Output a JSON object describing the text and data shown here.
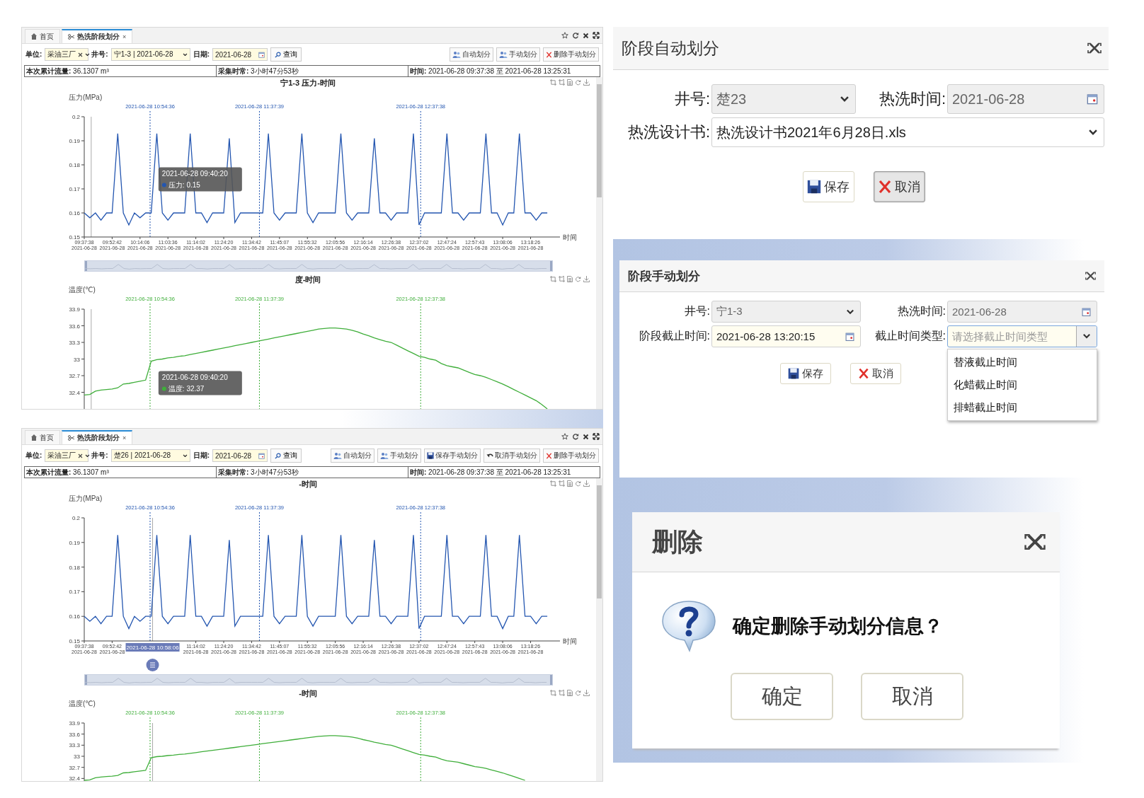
{
  "dashboard_panels": [
    {
      "tabs": [
        {
          "label": "首页",
          "kind": "home",
          "selected": false
        },
        {
          "label": "热洗阶段划分",
          "kind": "tool",
          "selected": true,
          "close": "×"
        }
      ],
      "filters": [
        {
          "label": "单位:",
          "value": "采油三厂",
          "kind": "clearable"
        },
        {
          "label": "井号:",
          "value": "宁1-3 | 2021-06-28",
          "kind": "select"
        },
        {
          "label": "日期:",
          "value": "2021-06-28",
          "kind": "date"
        }
      ],
      "query_button": "查询",
      "actions": [
        {
          "label": "自动划分",
          "kind": "auto"
        },
        {
          "label": "手动划分",
          "kind": "manual"
        },
        {
          "label": "删除手动划分",
          "kind": "delete"
        }
      ],
      "summary": [
        "**本次累计流量:** 36.1307 m³",
        "**采集时常:** 3小时47分53秒",
        "**时间:** 2021-06-28 09:37:38 至 2021-06-28 13:25:31"
      ],
      "zoom_slider": {
        "level": 1
      },
      "charts": [
        {
          "tooltip": {
            "title": "2021-06-28 09:40:20",
            "text": "压力: 0.15"
          },
          "chart_data": {
            "type": "line",
            "title": "宁1-3 压力-时间",
            "xlabel": "时间",
            "ylabel": "压力(MPa)",
            "categories": [
              "09:37:38 2021-06-28",
              null,
              null,
              null,
              null,
              "09:52:42 2021-06-28",
              null,
              null,
              null,
              null,
              "10:14:06 2021-06-28",
              null,
              null,
              null,
              null,
              "11:03:36 2021-06-28",
              null,
              null,
              null,
              null,
              "11:14:02 2021-06-28",
              null,
              null,
              null,
              null,
              "11:24:20 2021-06-28",
              null,
              null,
              null,
              null,
              "11:34:42 2021-06-28",
              null,
              null,
              null,
              null,
              "11:45:07 2021-06-28",
              null,
              null,
              null,
              null,
              "11:55:32 2021-06-28",
              null,
              null,
              null,
              null,
              "12:05:56 2021-06-28",
              null,
              null,
              null,
              null,
              "12:16:14 2021-06-28",
              null,
              null,
              null,
              null,
              "12:26:38 2021-06-28",
              null,
              null,
              null,
              null,
              "12:37:02 2021-06-28",
              null,
              null,
              null,
              null,
              "12:47:24 2021-06-28",
              null,
              null,
              null,
              null,
              "12:57:43 2021-06-28",
              null,
              null,
              null,
              null,
              "13:08:06 2021-06-28",
              null,
              null,
              null,
              null,
              "13:18:26 2021-06-28",
              null,
              null,
              null
            ],
            "series": [
              {
                "color": "#2456b0",
                "values": [
                  0.16,
                  0.158,
                  0.16,
                  0.157,
                  0.16,
                  0.16,
                  0.193,
                  0.16,
                  0.155,
                  0.16,
                  0.158,
                  0.16,
                  0.16,
                  0.193,
                  0.16,
                  0.157,
                  0.16,
                  0.16,
                  0.16,
                  0.193,
                  0.16,
                  0.16,
                  0.156,
                  0.16,
                  0.16,
                  0.16,
                  0.191,
                  0.156,
                  0.16,
                  0.16,
                  0.16,
                  0.16,
                  0.16,
                  0.193,
                  0.16,
                  0.157,
                  0.16,
                  0.16,
                  0.16,
                  0.193,
                  0.16,
                  0.156,
                  0.16,
                  0.16,
                  0.16,
                  0.16,
                  0.193,
                  0.16,
                  0.157,
                  0.16,
                  0.16,
                  0.16,
                  0.191,
                  0.16,
                  0.16,
                  0.157,
                  0.16,
                  0.16,
                  0.16,
                  0.193,
                  0.155,
                  0.16,
                  0.16,
                  0.16,
                  0.16,
                  0.193,
                  0.16,
                  0.16,
                  0.157,
                  0.16,
                  0.16,
                  0.16,
                  0.193,
                  0.16,
                  0.16,
                  0.155,
                  0.16,
                  0.16,
                  0.193,
                  0.16,
                  0.16,
                  0.157,
                  0.16,
                  0.16
                ]
              }
            ],
            "ylim": [
              0.15,
              0.2
            ],
            "yticks": [
              {
                "value": 0.15,
                "label": "0.15"
              },
              {
                "value": 0.16,
                "label": "0.16"
              },
              {
                "value": 0.17,
                "label": "0.17"
              },
              {
                "value": 0.18,
                "label": "0.18"
              },
              {
                "value": 0.19,
                "label": "0.19"
              },
              {
                "value": 0.2,
                "label": "0.2"
              }
            ],
            "annotations": [
              "2021-06-28 10:54:36",
              "2021-06-28 11:37:39",
              "2021-06-28 12:37:38"
            ]
          }
        },
        {
          "tooltip": {
            "title": "2021-06-28 09:40:20",
            "text": "温度: 32.37"
          },
          "chart_data": {
            "type": "line",
            "title": "度-时间",
            "ylabel": "温度(℃)",
            "categories": [
              null,
              null,
              null,
              null,
              null,
              null,
              null,
              null,
              null,
              null,
              null,
              null,
              null,
              null,
              null,
              null,
              null,
              null,
              null,
              null,
              null,
              null,
              null,
              null,
              null,
              null,
              null,
              null,
              null,
              null,
              null,
              null,
              null,
              null,
              null,
              null,
              null,
              null,
              null,
              null,
              null,
              null,
              null,
              null,
              null,
              null,
              null,
              null,
              null,
              null,
              null,
              null,
              null,
              null,
              null,
              null,
              null,
              null,
              null,
              null,
              null,
              null,
              null,
              null,
              null,
              null,
              null,
              null,
              null,
              null,
              null,
              null,
              null,
              null,
              null,
              null,
              null,
              null,
              null,
              null,
              null,
              null,
              null,
              null
            ],
            "series": [
              {
                "color": "#3fae3a",
                "values": [
                  32.35,
                  32.36,
                  32.42,
                  32.44,
                  32.45,
                  32.46,
                  32.48,
                  32.55,
                  32.56,
                  32.58,
                  32.6,
                  32.62,
                  32.96,
                  32.99,
                  33.0,
                  33.02,
                  33.03,
                  33.05,
                  33.06,
                  33.08,
                  33.1,
                  33.12,
                  33.14,
                  33.16,
                  33.18,
                  33.2,
                  33.22,
                  33.24,
                  33.26,
                  33.28,
                  33.3,
                  33.32,
                  33.34,
                  33.36,
                  33.38,
                  33.4,
                  33.42,
                  33.44,
                  33.46,
                  33.48,
                  33.5,
                  33.52,
                  33.54,
                  33.55,
                  33.56,
                  33.56,
                  33.55,
                  33.54,
                  33.52,
                  33.49,
                  33.45,
                  33.42,
                  33.38,
                  33.35,
                  33.32,
                  33.3,
                  33.25,
                  33.2,
                  33.15,
                  33.1,
                  33.05,
                  33.03,
                  33.0,
                  32.98,
                  32.92,
                  32.88,
                  32.86,
                  32.84,
                  32.8,
                  32.76,
                  32.72,
                  32.7,
                  32.67,
                  32.63,
                  32.59,
                  32.55,
                  32.5,
                  32.45,
                  32.4,
                  32.35,
                  32.3,
                  32.25,
                  32.18,
                  32.1
                ]
              }
            ],
            "ylim": [
              32.1,
              33.9
            ],
            "yticks": [
              {
                "value": 32.4,
                "label": "32.4"
              },
              {
                "value": 32.7,
                "label": "32.7"
              },
              {
                "value": 33,
                "label": "33"
              },
              {
                "value": 33.3,
                "label": "33.3"
              },
              {
                "value": 33.6,
                "label": "33.6"
              },
              {
                "value": 33.9,
                "label": "33.9"
              }
            ],
            "annotations": [
              "2021-06-28 10:54:36",
              "2021-06-28 11:37:39",
              "2021-06-28 12:37:38"
            ]
          }
        }
      ]
    },
    {
      "tabs": [
        {
          "label": "首页",
          "kind": "home",
          "selected": false
        },
        {
          "label": "热洗阶段划分",
          "kind": "tool",
          "selected": true,
          "close": "×"
        }
      ],
      "filters": [
        {
          "label": "单位:",
          "value": "采油三厂",
          "kind": "clearable"
        },
        {
          "label": "井号:",
          "value": "楚26 | 2021-06-28",
          "kind": "select"
        },
        {
          "label": "日期:",
          "value": "2021-06-28",
          "kind": "date"
        }
      ],
      "query_button": "查询",
      "actions": [
        {
          "label": "自动划分",
          "kind": "auto"
        },
        {
          "label": "手动划分",
          "kind": "manual"
        },
        {
          "label": "保存手动划分",
          "kind": "save"
        },
        {
          "label": "取消手动划分",
          "kind": "undo"
        },
        {
          "label": "删除手动划分",
          "kind": "delete"
        }
      ],
      "summary": [
        "**本次累计流量:** 36.1307 m³",
        "**采集时常:** 3小时47分53秒",
        "**时间:** 2021-06-28 09:37:38 至 2021-06-28 13:25:31"
      ],
      "zoom_slider": {
        "level": 1
      },
      "charts": [
        {
          "axis_pointer": "2021-06-28 10:58:06",
          "chart_data": {
            "type": "line",
            "title": "-时间",
            "xlabel": "时间",
            "ylabel": "压力(MPa)",
            "categories": [
              "09:37:38 2021-06-28",
              null,
              null,
              null,
              null,
              "09:52:42 2021-06-28",
              null,
              null,
              null,
              null,
              null,
              null,
              null,
              null,
              null,
              null,
              null,
              null,
              null,
              null,
              "11:14:02 2021-06-28",
              null,
              null,
              null,
              null,
              "11:24:20 2021-06-28",
              null,
              null,
              null,
              null,
              "11:34:42 2021-06-28",
              null,
              null,
              null,
              null,
              "11:45:07 2021-06-28",
              null,
              null,
              null,
              null,
              "11:55:32 2021-06-28",
              null,
              null,
              null,
              null,
              "12:05:56 2021-06-28",
              null,
              null,
              null,
              null,
              "12:16:14 2021-06-28",
              null,
              null,
              null,
              null,
              "12:26:38 2021-06-28",
              null,
              null,
              null,
              null,
              "12:37:02 2021-06-28",
              null,
              null,
              null,
              null,
              "12:47:24 2021-06-28",
              null,
              null,
              null,
              null,
              "12:57:43 2021-06-28",
              null,
              null,
              null,
              null,
              "13:08:06 2021-06-28",
              null,
              null,
              null,
              null,
              "13:18:26 2021-06-28",
              null,
              null,
              null
            ],
            "series": [
              {
                "color": "#2456b0",
                "values": [
                  0.16,
                  0.158,
                  0.16,
                  0.157,
                  0.16,
                  0.16,
                  0.193,
                  0.16,
                  0.155,
                  0.16,
                  0.158,
                  0.16,
                  0.16,
                  0.193,
                  0.16,
                  0.157,
                  0.16,
                  0.16,
                  0.16,
                  0.193,
                  0.16,
                  0.16,
                  0.156,
                  0.16,
                  0.16,
                  0.16,
                  0.191,
                  0.156,
                  0.16,
                  0.16,
                  0.16,
                  0.16,
                  0.16,
                  0.193,
                  0.16,
                  0.157,
                  0.16,
                  0.16,
                  0.16,
                  0.193,
                  0.16,
                  0.156,
                  0.16,
                  0.16,
                  0.16,
                  0.16,
                  0.193,
                  0.16,
                  0.157,
                  0.16,
                  0.16,
                  0.16,
                  0.191,
                  0.16,
                  0.16,
                  0.157,
                  0.16,
                  0.16,
                  0.16,
                  0.193,
                  0.155,
                  0.16,
                  0.16,
                  0.16,
                  0.16,
                  0.193,
                  0.16,
                  0.16,
                  0.157,
                  0.16,
                  0.16,
                  0.16,
                  0.193,
                  0.16,
                  0.16,
                  0.155,
                  0.16,
                  0.16,
                  0.193,
                  0.16,
                  0.16,
                  0.157,
                  0.16,
                  0.16
                ]
              }
            ],
            "ylim": [
              0.15,
              0.2
            ],
            "yticks": [
              {
                "value": 0.15,
                "label": "0.15"
              },
              {
                "value": 0.16,
                "label": "0.16"
              },
              {
                "value": 0.17,
                "label": "0.17"
              },
              {
                "value": 0.18,
                "label": "0.18"
              },
              {
                "value": 0.19,
                "label": "0.19"
              },
              {
                "value": 0.2,
                "label": "0.2"
              }
            ],
            "annotations": [
              "2021-06-28 10:54:36",
              "2021-06-28 11:37:39",
              "2021-06-28 12:37:38"
            ]
          }
        },
        {
          "chart_data": {
            "type": "line",
            "title": "-时间",
            "ylabel": "温度(℃)",
            "categories": [
              null,
              null,
              null,
              null,
              null,
              null,
              null,
              null,
              null,
              null,
              null,
              null,
              null,
              null,
              null,
              null,
              null,
              null,
              null,
              null,
              null,
              null,
              null,
              null,
              null,
              null,
              null,
              null,
              null,
              null,
              null,
              null,
              null,
              null,
              null,
              null,
              null,
              null,
              null,
              null,
              null,
              null,
              null,
              null,
              null,
              null,
              null,
              null,
              null,
              null,
              null,
              null,
              null,
              null,
              null,
              null,
              null,
              null,
              null,
              null,
              null,
              null,
              null,
              null,
              null,
              null,
              null,
              null,
              null,
              null,
              null,
              null,
              null,
              null,
              null,
              null,
              null,
              null,
              null,
              null,
              null,
              null,
              null,
              null
            ],
            "series": [
              {
                "color": "#3fae3a",
                "values": [
                  32.35,
                  32.36,
                  32.42,
                  32.44,
                  32.45,
                  32.46,
                  32.48,
                  32.55,
                  32.56,
                  32.58,
                  32.6,
                  32.62,
                  32.96,
                  32.99,
                  33.0,
                  33.02,
                  33.03,
                  33.05,
                  33.06,
                  33.08,
                  33.1,
                  33.12,
                  33.14,
                  33.16,
                  33.18,
                  33.2,
                  33.22,
                  33.24,
                  33.26,
                  33.28,
                  33.3,
                  33.32,
                  33.34,
                  33.36,
                  33.38,
                  33.4,
                  33.42,
                  33.44,
                  33.46,
                  33.48,
                  33.5,
                  33.52,
                  33.54,
                  33.55,
                  33.56,
                  33.56,
                  33.55,
                  33.54,
                  33.52,
                  33.49,
                  33.45,
                  33.42,
                  33.38,
                  33.35,
                  33.32,
                  33.3,
                  33.25,
                  33.2,
                  33.15,
                  33.1,
                  33.05,
                  33.03,
                  33.0,
                  32.98,
                  32.92,
                  32.88,
                  32.86,
                  32.84,
                  32.8,
                  32.76,
                  32.72,
                  32.7,
                  32.67,
                  32.63,
                  32.59,
                  32.55,
                  32.5,
                  32.45,
                  32.4,
                  32.35,
                  null,
                  null,
                  null,
                  null
                ]
              }
            ],
            "ylim": [
              32.33,
              33.9
            ],
            "yticks": [
              {
                "value": 32.4,
                "label": "32.4"
              },
              {
                "value": 32.7,
                "label": "32.7"
              },
              {
                "value": 33,
                "label": "33"
              },
              {
                "value": 33.3,
                "label": "33.3"
              },
              {
                "value": 33.6,
                "label": "33.6"
              },
              {
                "value": 33.9,
                "label": "33.9"
              }
            ],
            "annotations": [
              "2021-06-28 10:54:36",
              "2021-06-28 11:37:39",
              "2021-06-28 12:37:38"
            ]
          }
        }
      ]
    }
  ],
  "auto_dialog": {
    "title": "阶段自动划分",
    "rows": [
      [
        {
          "label": "井号:",
          "value": "楚23",
          "kind": "select",
          "disabled": true
        },
        {
          "label": "热洗时间:",
          "value": "2021-06-28",
          "kind": "date",
          "disabled": true
        }
      ],
      [
        {
          "label": "热洗设计书:",
          "value": "热洗设计书2021年6月28日.xls",
          "kind": "select",
          "disabled": false
        }
      ]
    ],
    "buttons": [
      {
        "label": "保存",
        "kind": "save",
        "pressed": false
      },
      {
        "label": "取消",
        "kind": "cancel",
        "pressed": true
      }
    ]
  },
  "manual_dialog": {
    "title": "阶段手动划分",
    "rows": [
      [
        {
          "label": "井号:",
          "value": "宁1-3",
          "kind": "select",
          "disabled": true
        },
        {
          "label": "热洗时间:",
          "value": "2021-06-28",
          "kind": "date",
          "disabled": true
        }
      ],
      [
        {
          "label": "阶段截止时间:",
          "value": "2021-06-28 13:20:15",
          "kind": "date",
          "disabled": false
        },
        {
          "label": "截止时间类型:",
          "placeholder": "请选择截止时间类型",
          "kind": "select",
          "disabled": false,
          "open": true,
          "options": [
            "替液截止时间",
            "化蜡截止时间",
            "排蜡截止时间"
          ]
        }
      ]
    ],
    "buttons": [
      {
        "label": "保存",
        "kind": "save",
        "pressed": false
      },
      {
        "label": "取消",
        "kind": "cancel",
        "pressed": false
      }
    ]
  },
  "delete_dialog": {
    "title": "删除",
    "message": "确定删除手动划分信息？",
    "buttons": [
      {
        "label": "确定"
      },
      {
        "label": "取消"
      }
    ]
  }
}
